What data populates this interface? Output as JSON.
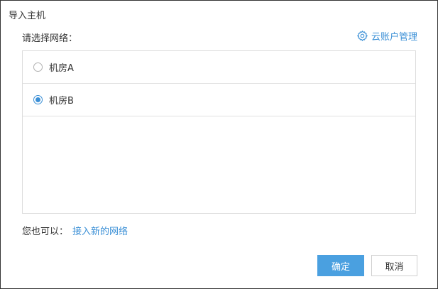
{
  "dialog": {
    "title": "导入主机",
    "section_label": "请选择网络：",
    "cloud_account_link": "云账户管理",
    "cloud_account_icon": "gear-icon",
    "networks": [
      {
        "label": "机房A",
        "selected": false
      },
      {
        "label": "机房B",
        "selected": true
      }
    ],
    "also_prefix": "您也可以：",
    "also_link": "接入新的网络",
    "ok_label": "确定",
    "cancel_label": "取消"
  },
  "colors": {
    "accent": "#3a8fd6",
    "primary_button": "#4aa0e0",
    "border": "#dcdcdc"
  }
}
